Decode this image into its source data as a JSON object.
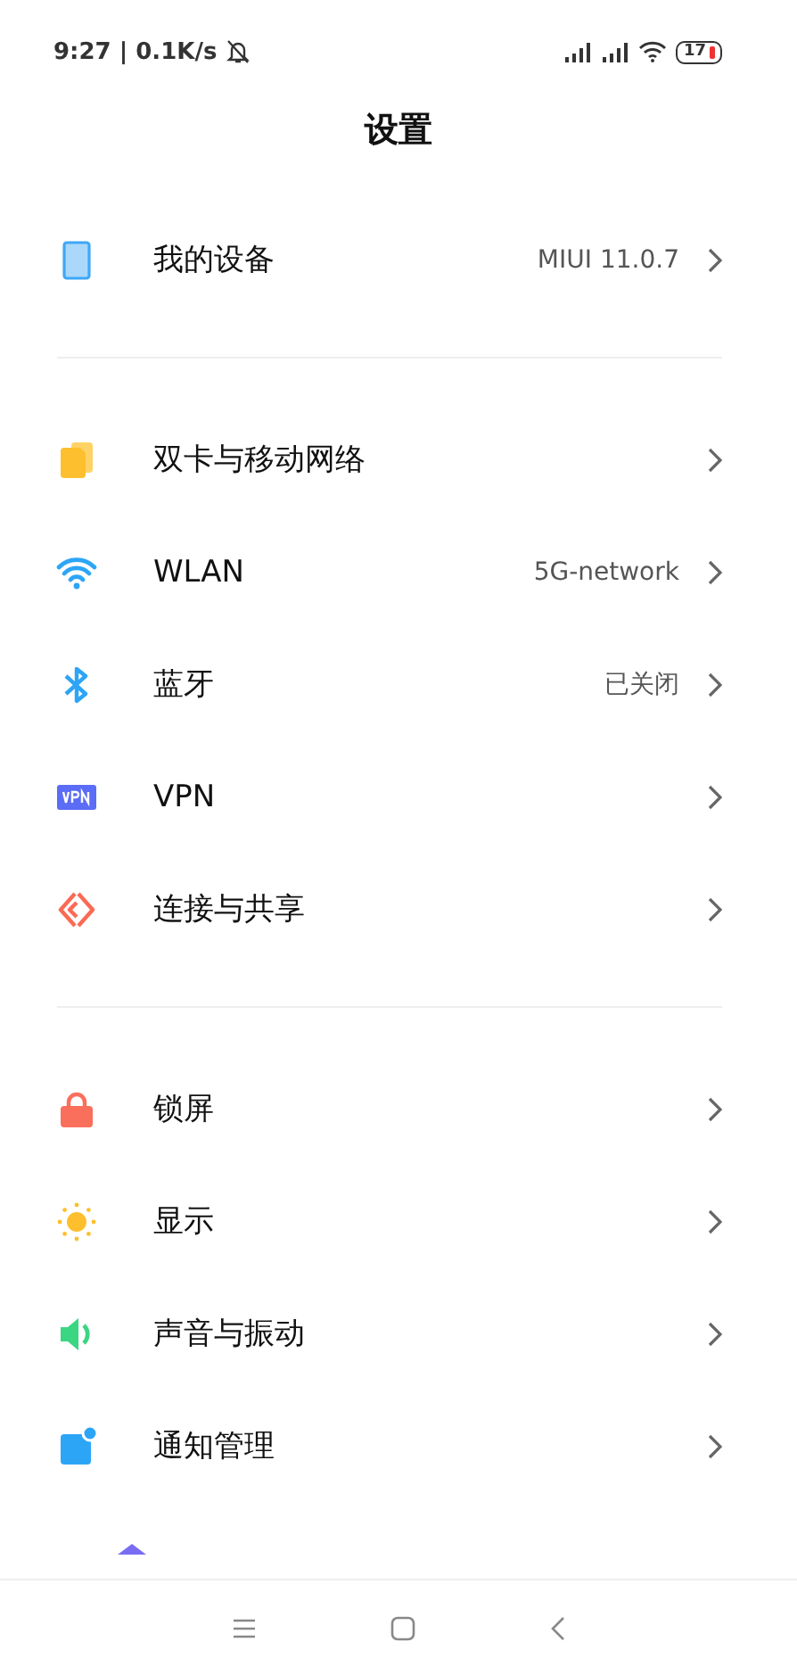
{
  "status_bar": {
    "time": "9:27 | 0.1K/s",
    "battery": "17"
  },
  "title": "设置",
  "sections": [
    {
      "items": [
        {
          "kind": "device",
          "label": "我的设备",
          "value": "MIUI 11.0.7"
        }
      ]
    },
    {
      "items": [
        {
          "kind": "sim",
          "label": "双卡与移动网络"
        },
        {
          "kind": "wifi",
          "label": "WLAN",
          "value": "5G-network"
        },
        {
          "kind": "bluetooth",
          "label": "蓝牙",
          "value": "已关闭"
        },
        {
          "kind": "vpn",
          "label": "VPN"
        },
        {
          "kind": "share",
          "label": "连接与共享"
        }
      ]
    },
    {
      "items": [
        {
          "kind": "lock",
          "label": "锁屏"
        },
        {
          "kind": "sun",
          "label": "显示"
        },
        {
          "kind": "sound",
          "label": "声音与振动"
        },
        {
          "kind": "notify",
          "label": "通知管理"
        },
        {
          "kind": "desktop"
        }
      ]
    }
  ]
}
